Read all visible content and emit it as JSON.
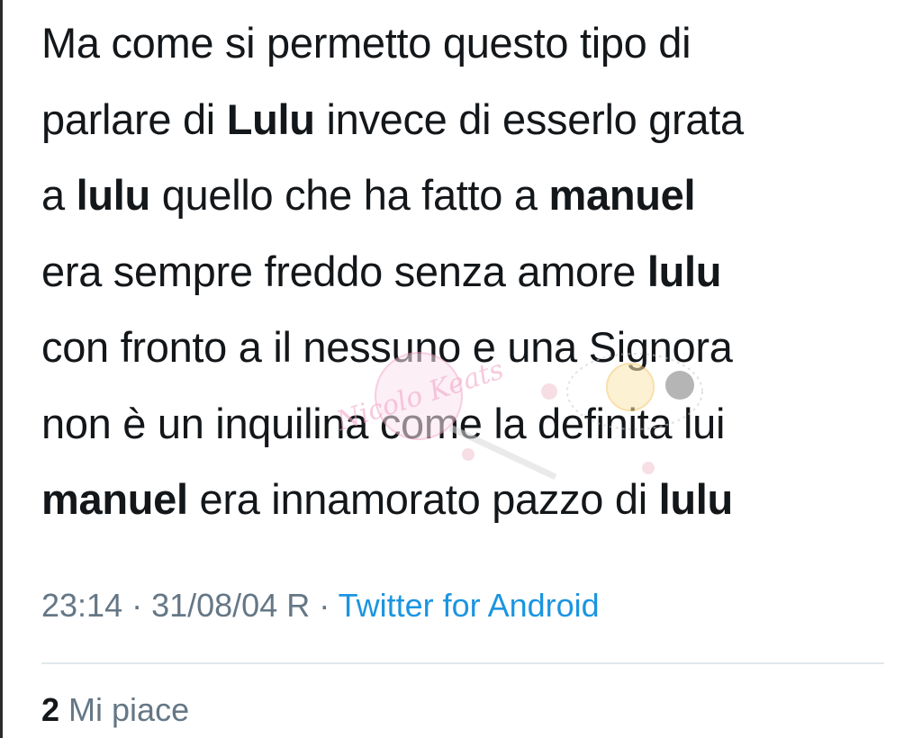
{
  "tweet": {
    "lines": [
      [
        {
          "t": "Ma come si permetto questo tipo di",
          "b": false
        }
      ],
      [
        {
          "t": "parlare  di  ",
          "b": false
        },
        {
          "t": "Lulu",
          "b": true
        },
        {
          "t": " invece di esserlo grata",
          "b": false
        }
      ],
      [
        {
          "t": "a ",
          "b": false
        },
        {
          "t": "lulu",
          "b": true
        },
        {
          "t": " quello che ha fatto  a ",
          "b": false
        },
        {
          "t": "manuel",
          "b": true
        }
      ],
      [
        {
          "t": "era sempre freddo senza amore ",
          "b": false
        },
        {
          "t": "lulu",
          "b": true
        }
      ],
      [
        {
          "t": "con fronto a il nessuno  e una Signora",
          "b": false
        }
      ],
      [
        {
          "t": "non è  un inquilina come la definita lui",
          "b": false
        }
      ],
      [
        {
          "t": "manuel",
          "b": true
        },
        {
          "t": "  era innamorato  pazzo di ",
          "b": false
        },
        {
          "t": "lulu",
          "b": true
        }
      ]
    ],
    "timestamp": "23:14 · 31/08/04 R · ",
    "source": "Twitter for Android",
    "likes_count": "2",
    "likes_label": " Mi piace"
  },
  "watermark": {
    "text": "Nicolo Keats",
    "color": "#f2a7c8"
  },
  "colors": {
    "text": "#14171a",
    "secondary": "#657786",
    "link": "#1b95e0",
    "divider": "#e1e8ed"
  }
}
